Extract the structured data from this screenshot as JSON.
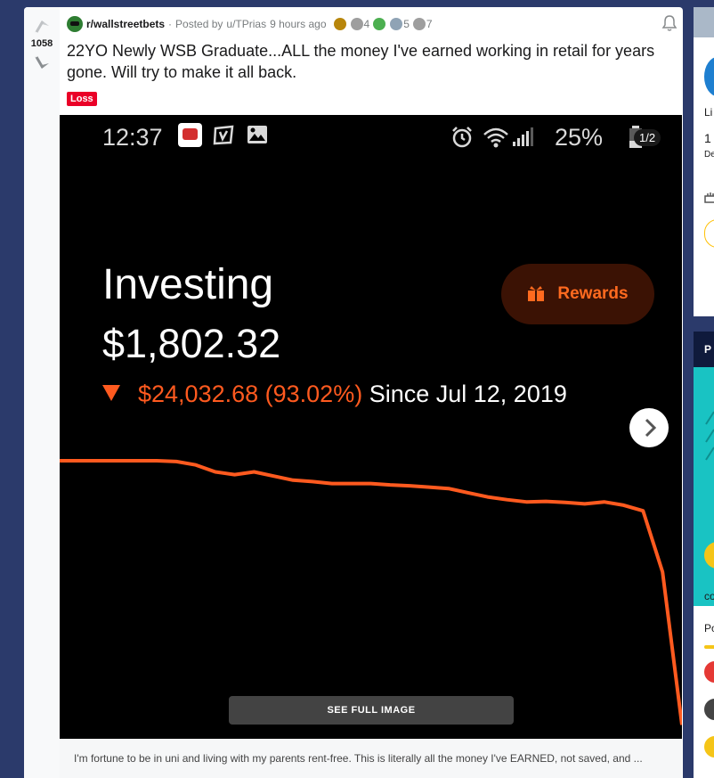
{
  "post": {
    "score": "1058",
    "subreddit": "r/wallstreetbets",
    "posted_by": "Posted by",
    "author": "u/TPrias",
    "time_ago": "9 hours ago",
    "awards": [
      {
        "icon": "gold-coin-award-icon",
        "count": "",
        "color": "#b8860b"
      },
      {
        "icon": "silver-award-icon",
        "count": "4",
        "color": "#9e9e9e"
      },
      {
        "icon": "stonks-award-icon",
        "count": "",
        "color": "#4caf50"
      },
      {
        "icon": "helpful-award-icon",
        "count": "5",
        "color": "#8fa3b5"
      },
      {
        "icon": "dollar-award-icon",
        "count": "7",
        "color": "#9e9e9e"
      }
    ],
    "title": "22YO Newly WSB Graduate...ALL the money I've earned working in retail for years gone. Will try to make it all back.",
    "flair": "Loss",
    "caption": "I'm fortune to be in uni and living with my parents rent-free. This is literally all the money I've EARNED, not saved, and ..."
  },
  "screenshot": {
    "time": "12:37",
    "battery": "25%",
    "pager": "1/2",
    "heading": "Investing",
    "value": "$1,802.32",
    "change": "$24,032.68 (93.02%)",
    "since": "Since Jul 12, 2019",
    "rewards_label": "Rewards",
    "see_full_image": "SEE FULL IMAGE"
  },
  "sidebar": {
    "text1": "Li",
    "text2": "1",
    "text3": "De",
    "head2": "P",
    "text4": "co",
    "text5": "Po"
  },
  "colors": {
    "accent_orange": "#ff5a1f",
    "flair_red": "#ea0027",
    "page_bg": "#2b3a6b"
  },
  "chart_data": {
    "type": "line",
    "series": [
      {
        "values": [
          1.0,
          1.0,
          1.0,
          1.0,
          1.0,
          1.0,
          0.997,
          0.985,
          0.96,
          0.95,
          0.96,
          0.945,
          0.93,
          0.925,
          0.918,
          0.918,
          0.918,
          0.913,
          0.91,
          0.905,
          0.9,
          0.885,
          0.87,
          0.86,
          0.852,
          0.854,
          0.85,
          0.845,
          0.852,
          0.84,
          0.82,
          0.6,
          0.05
        ]
      }
    ]
  }
}
